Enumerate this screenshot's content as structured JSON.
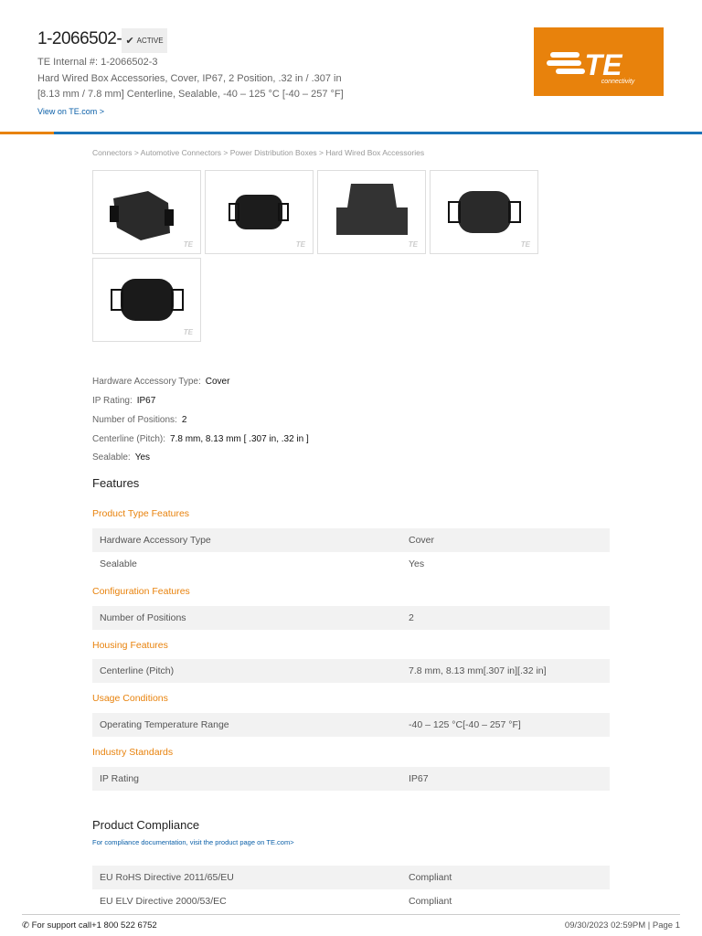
{
  "header": {
    "part_number": "1-2066502-3",
    "status": "ACTIVE",
    "internal": "TE Internal #: 1-2066502-3",
    "description_line1": "Hard Wired Box Accessories, Cover, IP67, 2 Position, .32 in / .307 in",
    "description_line2": "[8.13 mm / 7.8 mm] Centerline, Sealable, -40 – 125 °C [-40 – 257 °F]",
    "view_link": "View on TE.com >",
    "logo_text": "TE",
    "logo_sub": "connectivity"
  },
  "breadcrumb": "Connectors > Automotive Connectors > Power Distribution Boxes > Hard Wired Box Accessories",
  "thumbnail_watermark": "TE",
  "specs": [
    {
      "label": "Hardware Accessory Type:",
      "value": "Cover"
    },
    {
      "label": "IP Rating:",
      "value": "IP67"
    },
    {
      "label": "Number of Positions:",
      "value": "2"
    },
    {
      "label": "Centerline (Pitch):",
      "value": "7.8 mm, 8.13 mm [ .307 in, .32 in ]"
    },
    {
      "label": "Sealable:",
      "value": "Yes"
    }
  ],
  "features": {
    "title": "Features",
    "groups": [
      {
        "title": "Product Type Features",
        "rows": [
          [
            "Hardware Accessory Type",
            "Cover"
          ],
          [
            "Sealable",
            "Yes"
          ]
        ]
      },
      {
        "title": "Configuration Features",
        "rows": [
          [
            "Number of Positions",
            "2"
          ]
        ]
      },
      {
        "title": "Housing Features",
        "rows": [
          [
            "Centerline (Pitch)",
            "7.8 mm, 8.13 mm[.307 in][.32 in]"
          ]
        ]
      },
      {
        "title": "Usage Conditions",
        "rows": [
          [
            "Operating Temperature Range",
            "-40 – 125 °C[-40 – 257 °F]"
          ]
        ]
      },
      {
        "title": "Industry Standards",
        "rows": [
          [
            "IP Rating",
            "IP67"
          ]
        ]
      }
    ]
  },
  "compliance": {
    "title": "Product Compliance",
    "note": "For compliance documentation, visit the product page on TE.com>",
    "rows": [
      [
        "EU RoHS Directive 2011/65/EU",
        "Compliant"
      ],
      [
        "EU ELV Directive 2000/53/EC",
        "Compliant"
      ]
    ]
  },
  "footer": {
    "support": "For support call+1 800 522 6752",
    "date_page": "09/30/2023 02:59PM | Page 1"
  }
}
